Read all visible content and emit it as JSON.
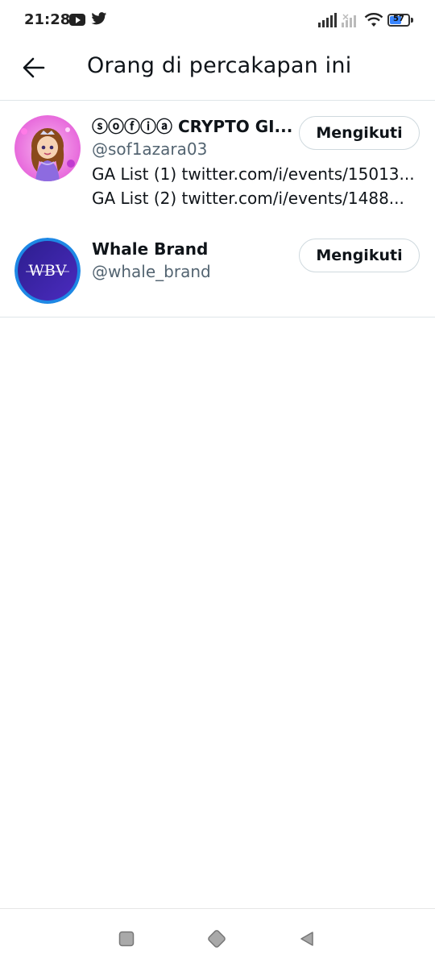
{
  "status_bar": {
    "time": "21:28",
    "battery": "57"
  },
  "header": {
    "title": "Orang di percakapan ini"
  },
  "users": [
    {
      "name": "ⓢⓞⓕⓘⓐ CRYPTO GI...",
      "handle": "@sof1azara03",
      "bio": [
        "GA List (1) twitter.com/i/events/15013...",
        "GA List (2) twitter.com/i/events/1488..."
      ],
      "follow_label": "Mengikuti"
    },
    {
      "name": "Whale Brand",
      "handle": "@whale_brand",
      "avatar_text": "WBV",
      "follow_label": "Mengikuti"
    }
  ],
  "colors": {
    "text_primary": "#0f1419",
    "text_secondary": "#536471",
    "divider": "#dfe6e9",
    "button_border": "#cfd9de",
    "battery_fill": "#3a86ff"
  }
}
